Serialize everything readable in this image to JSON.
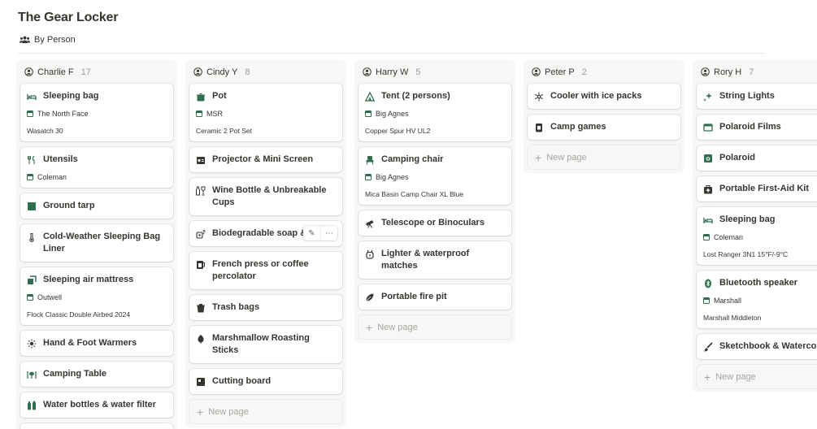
{
  "page": {
    "title": "The Gear Locker"
  },
  "view_tab": {
    "label": "By Person",
    "icon": "people-icon"
  },
  "new_page_label": "New page",
  "columns": [
    {
      "person": "Charlie F",
      "count": "17",
      "cards": [
        {
          "title": "Sleeping bag",
          "icon": "bed-icon",
          "brand": "The North Face",
          "model": "Wasatch 30"
        },
        {
          "title": "Utensils",
          "icon": "fork-knife-icon",
          "brand": "Coleman"
        },
        {
          "title": "Ground tarp",
          "icon": "square-icon"
        },
        {
          "title": "Cold-Weather Sleeping Bag Liner",
          "icon": "thermometer-icon"
        },
        {
          "title": "Sleeping air mattress",
          "icon": "mattress-icon",
          "brand": "Outwell",
          "model": "Flock Classic Double Airbed 2024"
        },
        {
          "title": "Hand & Foot Warmers",
          "icon": "sun-icon"
        },
        {
          "title": "Camping Table",
          "icon": "table-icon"
        },
        {
          "title": "Water bottles & water filter",
          "icon": "bottles-icon"
        }
      ]
    },
    {
      "person": "Cindy Y",
      "count": "8",
      "cards": [
        {
          "title": "Pot",
          "icon": "pot-icon",
          "brand": "MSR",
          "model": "Ceramic 2 Pot Set"
        },
        {
          "title": "Projector & Mini Screen",
          "icon": "projector-icon"
        },
        {
          "title": "Wine Bottle & Unbreakable Cups",
          "icon": "wine-icon"
        },
        {
          "title": "Biodegradable soap & sponge",
          "icon": "soap-icon"
        },
        {
          "title": "French press or coffee percolator",
          "icon": "coffee-icon"
        },
        {
          "title": "Trash bags",
          "icon": "trash-icon"
        },
        {
          "title": "Marshmallow Roasting Sticks",
          "icon": "marshmallow-icon"
        },
        {
          "title": "Cutting board",
          "icon": "board-icon"
        }
      ]
    },
    {
      "person": "Harry W",
      "count": "5",
      "cards": [
        {
          "title": "Tent (2 persons)",
          "icon": "tent-icon",
          "brand": "Big Agnes",
          "model": "Copper Spur HV UL2"
        },
        {
          "title": "Camping chair",
          "icon": "chair-icon",
          "brand": "Big Agnes",
          "model": "Mica Basin Camp Chair XL Blue"
        },
        {
          "title": "Telescope or Binoculars",
          "icon": "telescope-icon"
        },
        {
          "title": "Lighter & waterproof matches",
          "icon": "lighter-icon"
        },
        {
          "title": "Portable fire pit",
          "icon": "fire-icon"
        }
      ]
    },
    {
      "person": "Peter P",
      "count": "2",
      "cards": [
        {
          "title": "Cooler with ice packs",
          "icon": "snowflake-icon"
        },
        {
          "title": "Camp games",
          "icon": "cards-icon"
        }
      ]
    },
    {
      "person": "Rory H",
      "count": "7",
      "cards": [
        {
          "title": "String Lights",
          "icon": "sparkle-icon"
        },
        {
          "title": "Polaroid Films",
          "icon": "film-icon"
        },
        {
          "title": "Polaroid",
          "icon": "camera-icon"
        },
        {
          "title": "Portable First-Aid Kit",
          "icon": "first-aid-icon"
        },
        {
          "title": "Sleeping bag",
          "icon": "bed-icon",
          "brand": "Coleman",
          "model": "Lost Ranger 3N1 15°F/-9°C"
        },
        {
          "title": "Bluetooth speaker",
          "icon": "bluetooth-icon",
          "brand": "Marshall",
          "model": "Marshall Middleton"
        },
        {
          "title": "Sketchbook & Watercolors",
          "icon": "brush-icon"
        }
      ]
    }
  ],
  "colors": {
    "accent_icon": "#2f6e4f",
    "background": "#ffffff",
    "column_bg": "#f7f7f5",
    "muted_text": "#9b9a97"
  }
}
